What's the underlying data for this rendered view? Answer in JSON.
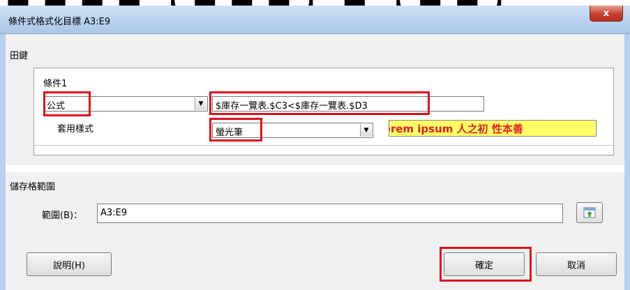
{
  "dialog": {
    "title": "條件式格式化目標 A3:E9",
    "close_label": "x"
  },
  "conditions_section": {
    "label": "田鍵",
    "condition_label": "條件1",
    "type_value": "公式",
    "formula_value": "$庫存一覽表.$C3<$庫存一覽表.$D3",
    "apply_style_label": "套用樣式",
    "style_value": "螢光筆",
    "preview_text": "Lorem ipsum   人之初 性本善",
    "dropdown_glyph": "▼"
  },
  "range_section": {
    "label": "儲存格範圍",
    "range_label": "範圍(B)：",
    "range_value": "A3:E9"
  },
  "buttons": {
    "help": "說明(H)",
    "ok": "確定",
    "cancel": "取消"
  },
  "colors": {
    "highlight_red": "#e0101e",
    "preview_background": "#ffff66",
    "preview_text": "#e0202a"
  }
}
